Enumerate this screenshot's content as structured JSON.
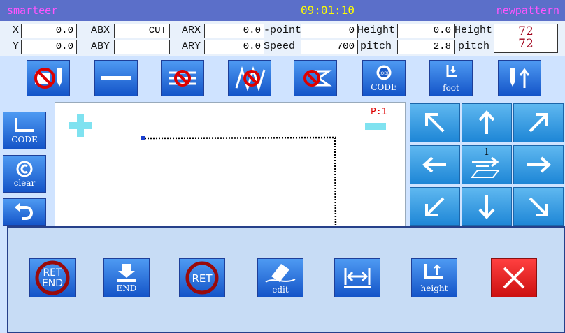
{
  "title": {
    "app": "smarteer",
    "time": "09:01:10",
    "pattern": "newpattern"
  },
  "info": {
    "row1": {
      "x_label": "X",
      "x_value": "0.0",
      "abx_label": "ABX",
      "abx_value": "CUT",
      "arx_label": "ARX",
      "arx_value": "0.0",
      "point_label": "-point",
      "point_value": "0",
      "height_label": "Height",
      "height_value": "0.0",
      "height2_label": "Height",
      "height2_value": "72"
    },
    "row2": {
      "y_label": "Y",
      "y_value": "0.0",
      "aby_label": "ABY",
      "aby_value": "",
      "ary_label": "ARY",
      "ary_value": "0.0",
      "speed_label": "Speed",
      "speed_value": "700",
      "pitch_label": "pitch",
      "pitch_value": "2.8",
      "pitch2_label": "pitch",
      "pitch2_value": "72"
    }
  },
  "toolbar": {
    "code_label": "CODE",
    "foot_label": "foot"
  },
  "sidebar": {
    "code_label": "CODE",
    "clear_label": "clear"
  },
  "canvas": {
    "page_label": "P:1"
  },
  "pad": {
    "center_number": "1"
  },
  "dialog": {
    "end_label": "END",
    "edit_label": "edit",
    "height_label": "height",
    "ret_end_line1": "RET",
    "ret_end_line2": "END",
    "ret_label": "RET"
  },
  "colors": {
    "titlebar": "#5b6fc9",
    "button": "#1454c8",
    "pad": "#1e86d6",
    "close": "#e02020",
    "accent_red": "#a0001a"
  },
  "icons": [
    "no-sew-icon",
    "line-icon",
    "cancel-zigzag-icon",
    "zigzag-cancel-icon",
    "no-feed-icon",
    "code-icon",
    "foot-icon",
    "needle-up-icon",
    "code-side-icon",
    "clear-icon",
    "undo-icon",
    "arrow-icons",
    "ret-end-icon",
    "end-icon",
    "ret-icon",
    "eraser-icon",
    "width-icon",
    "height-icon",
    "close-icon"
  ]
}
